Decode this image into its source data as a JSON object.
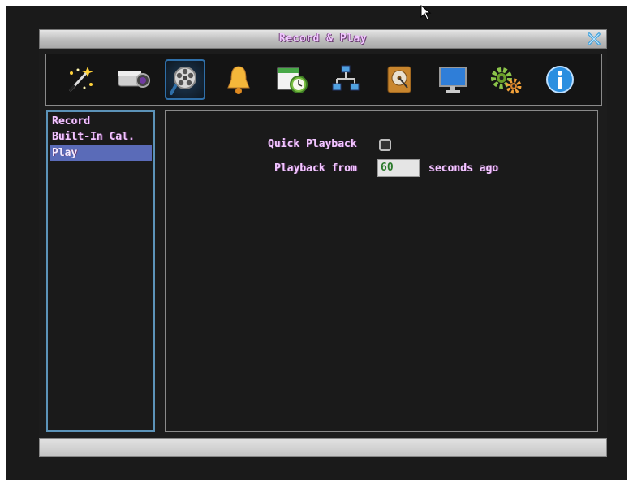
{
  "window": {
    "title": "Record & Play"
  },
  "toolbar": {
    "icons": [
      {
        "name": "wizard-icon"
      },
      {
        "name": "camera-icon"
      },
      {
        "name": "record-play-icon",
        "active": true
      },
      {
        "name": "alarm-bell-icon"
      },
      {
        "name": "schedule-icon"
      },
      {
        "name": "network-icon"
      },
      {
        "name": "disk-icon"
      },
      {
        "name": "display-icon"
      },
      {
        "name": "settings-icon"
      },
      {
        "name": "info-icon"
      }
    ]
  },
  "sidebar": {
    "items": [
      {
        "label": "Record"
      },
      {
        "label": "Built-In Cal."
      },
      {
        "label": "Play",
        "selected": true
      }
    ]
  },
  "form": {
    "quick_playback_label": "Quick Playback",
    "quick_playback_checked": false,
    "playback_from_label": "Playback from",
    "playback_from_value": "60",
    "seconds_ago_label": "seconds ago"
  },
  "colors": {
    "accent_text": "#f1c6ff",
    "selection": "#5a6bb8",
    "sidebar_border": "#5c93b8"
  }
}
